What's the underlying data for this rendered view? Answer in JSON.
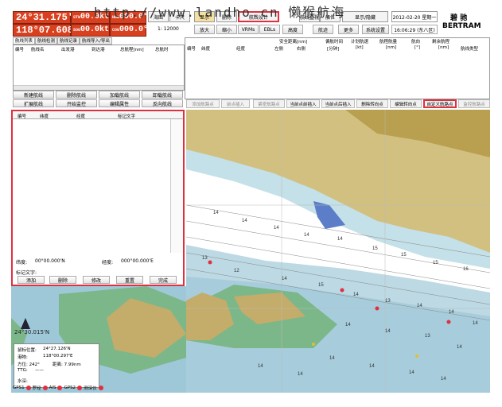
{
  "watermark": "http://www.landho.cn 懒猴航海",
  "position": {
    "lat": "24°31.175'N",
    "lon": "118°07.608'E",
    "stw": "STW",
    "stw_val": "00.0kt",
    "hdg": "HDG",
    "hdg_val": "000.0°",
    "sog": "SOG",
    "sog_val": "00.0kt",
    "cog": "COG",
    "cog_val": "000.0°"
  },
  "toolbar": {
    "row1": [
      "海图",
      "卡尺",
      "显示",
      "删除",
      "航线设计",
      "航线监视",
      "船位",
      "隐藏",
      "显示/隐藏"
    ],
    "scale_label": "1:",
    "scale": "12000",
    "row2": [
      "放大",
      "缩小",
      "VRMs",
      "EBLs",
      "高度",
      "航迹",
      "更多",
      "系统设置"
    ],
    "date": "2012-02-20 星期一",
    "time": "16:06:29 (东八区)",
    "ship_cn": "碧 驰",
    "ship_en": "BERTRAM"
  },
  "tabs": [
    "航线列表",
    "航线检测",
    "航线记录",
    "航线导入/导出"
  ],
  "route_list_headers": [
    "编号",
    "航线名",
    "出发港",
    "到达港",
    "总航程[nm]",
    "总航时"
  ],
  "route_buttons": [
    "新建航线",
    "删除航线",
    "加载航线",
    "卸载航线",
    "扩展航线",
    "开始监控",
    "编辑属性",
    "反向航线"
  ],
  "wp_headers_top": [
    "安全距离[nm]",
    "偏航时间",
    "计划航速",
    "航程航量",
    "航向",
    "剩余航程"
  ],
  "wp_headers": [
    "编号",
    "纬度",
    "经度",
    "左侧",
    "右侧",
    "[分钟]",
    "[kt]",
    "[nm]",
    "[°]",
    "[nm]",
    "航线类型"
  ],
  "wp_buttons": [
    "添加航路点",
    "前点插入",
    "紧密航路点",
    "当前点前插入",
    "当前点后插入",
    "删除转向点",
    "编辑转向点",
    "自定义航路点",
    "监控航路点"
  ],
  "panel": {
    "headers": [
      "编号",
      "纬度",
      "经度",
      "标记文字"
    ],
    "lat_label": "纬度:",
    "lat_val": "00°00.000'N",
    "lon_label": "经度:",
    "lon_val": "000°00.000'E",
    "mark_label": "标记文字:",
    "buttons": [
      "添加",
      "删除",
      "修改",
      "重置",
      "完成"
    ]
  },
  "map": {
    "lat_label": "24°30.015'N",
    "depths": [
      "14",
      "14",
      "14",
      "14",
      "14",
      "15",
      "15",
      "15",
      "16",
      "13",
      "12",
      "14",
      "15",
      "14",
      "13",
      "14",
      "14",
      "14",
      "14",
      "14",
      "13",
      "14",
      "14",
      "14",
      "14",
      "14",
      "14",
      "14"
    ]
  },
  "info": {
    "pos_label": "鼠标位置:",
    "lat": "24°27.126'N",
    "lon_label": "港物:",
    "lon": "118°00.297'E",
    "bearing_label": "方位: 242°",
    "dist_label": "距离: 7.99nm",
    "ttg_label": "TTG:",
    "ttg": "——",
    "water_label": "水深:"
  },
  "status": [
    "GPS1",
    "罗经",
    "AIS",
    "GPS2",
    "测深仪"
  ]
}
